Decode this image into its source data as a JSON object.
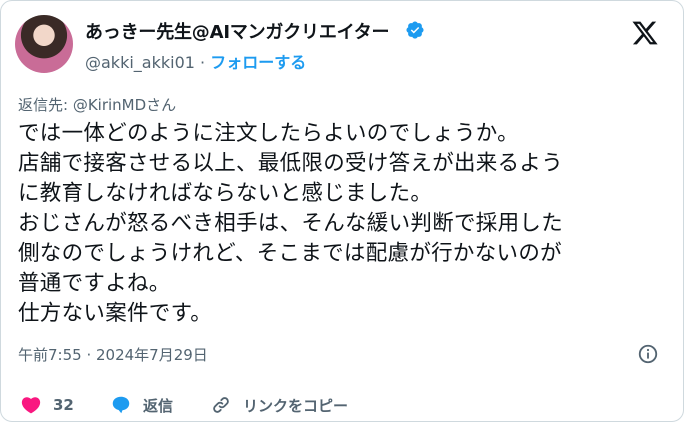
{
  "author": {
    "display_name": "あっきー先生@AIマンガクリエイター",
    "handle": "@akki_akki01",
    "separator": "·",
    "follow_label": "フォローする"
  },
  "reply_to": "返信先: @KirinMDさん",
  "text_lines": [
    "では一体どのように注文したらよいのでしょうか。",
    "店舗で接客させる以上、最低限の受け答えが出来るよう",
    "に教育しなければならないと感じました。",
    "おじさんが怒るべき相手は、そんな緩い判断で採用した",
    "側なのでしょうけれど、そこまでは配慮が行かないのが",
    "普通ですよね。",
    "仕方ない案件です。"
  ],
  "timestamp": "午前7:55 · 2024年7月29日",
  "actions": {
    "like_count": "32",
    "reply_label": "返信",
    "copy_link_label": "リンクをコピー"
  },
  "colors": {
    "accent": "#1d9bf0",
    "like": "#f91880",
    "muted": "#536471",
    "text": "#0f1419"
  },
  "icons": [
    "verified-badge-icon",
    "x-logo-icon",
    "info-icon",
    "heart-icon",
    "reply-bubble-icon",
    "link-icon"
  ]
}
